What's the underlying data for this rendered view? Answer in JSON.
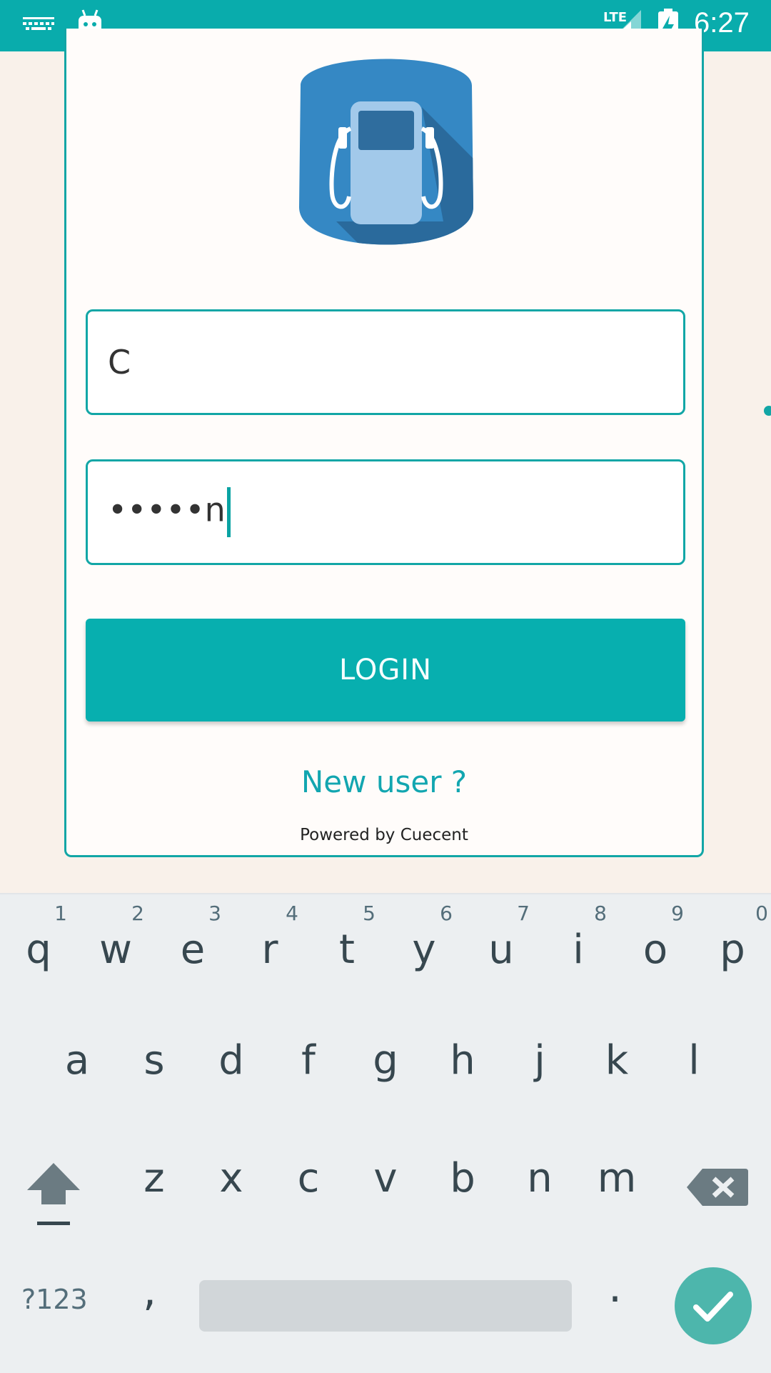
{
  "status_bar": {
    "time": "6:27",
    "network": "LTE",
    "icons": [
      "keyboard-icon",
      "android-icon",
      "signal-icon",
      "battery-charging-icon"
    ]
  },
  "login": {
    "logo_icon": "fuel-pump-icon",
    "username_value": "C",
    "password_value": "•••••n",
    "login_label": "LOGIN",
    "new_user_label": "New user ?",
    "powered_by": "Powered by Cuecent"
  },
  "keyboard": {
    "row1": [
      {
        "key": "q",
        "hint": "1"
      },
      {
        "key": "w",
        "hint": "2"
      },
      {
        "key": "e",
        "hint": "3"
      },
      {
        "key": "r",
        "hint": "4"
      },
      {
        "key": "t",
        "hint": "5"
      },
      {
        "key": "y",
        "hint": "6"
      },
      {
        "key": "u",
        "hint": "7"
      },
      {
        "key": "i",
        "hint": "8"
      },
      {
        "key": "o",
        "hint": "9"
      },
      {
        "key": "p",
        "hint": "0"
      }
    ],
    "row2": [
      "a",
      "s",
      "d",
      "f",
      "g",
      "h",
      "j",
      "k",
      "l"
    ],
    "row3": [
      "z",
      "x",
      "c",
      "v",
      "b",
      "n",
      "m"
    ],
    "symbols_label": "?123",
    "comma": ",",
    "period": "."
  },
  "colors": {
    "accent": "#09acac",
    "card_border": "#12a6a6",
    "keyboard_bg": "#eceff1",
    "done_key": "#4db6ac"
  }
}
